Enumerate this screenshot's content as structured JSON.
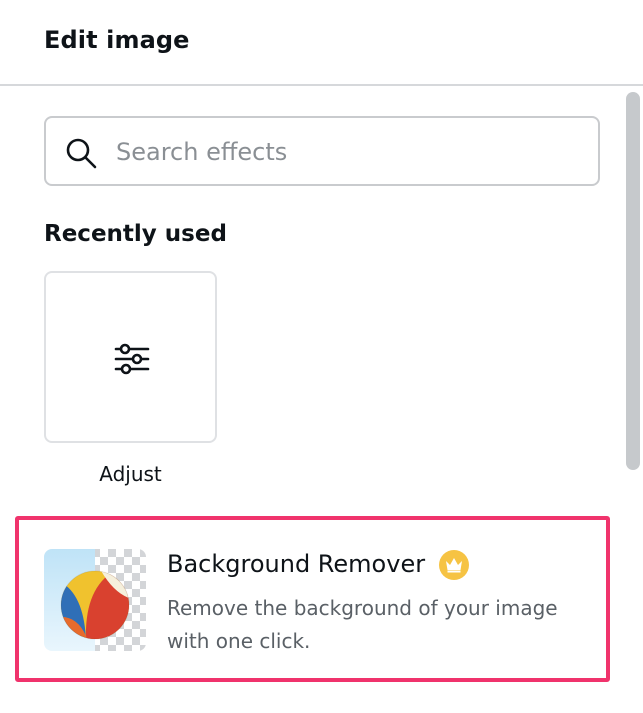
{
  "header": {
    "title": "Edit image"
  },
  "search": {
    "placeholder": "Search effects",
    "value": ""
  },
  "recently_used": {
    "heading": "Recently used",
    "items": [
      {
        "label": "Adjust",
        "icon": "sliders-icon"
      }
    ]
  },
  "feature": {
    "title": "Background Remover",
    "description": "Remove the background of your image with one click.",
    "badge_icon": "crown-icon",
    "thumbnail": "beach-ball-thumbnail",
    "highlight_color": "#f0336c"
  },
  "colors": {
    "text": "#0e1318",
    "muted_text": "#5a6066",
    "border": "#c9cbce",
    "crown_badge": "#f6c343"
  }
}
